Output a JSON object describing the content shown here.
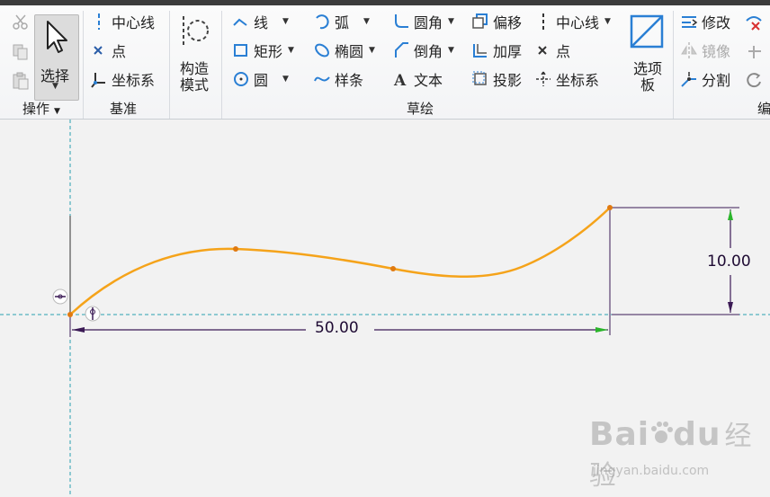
{
  "colors": {
    "accent": "#2a7fd4",
    "curve": "#f5a31a",
    "dimension": "#3b1a55",
    "axis": "#2aa0b0",
    "arrow_green": "#2bb52b"
  },
  "ops": {
    "select_label": "选择",
    "group_label": "操作"
  },
  "datum": {
    "items": [
      "中心线",
      "点",
      "坐标系"
    ],
    "group_label": "基准"
  },
  "construct": {
    "label_line1": "构造",
    "label_line2": "模式"
  },
  "sketch": {
    "col1": [
      "线",
      "矩形",
      "圆"
    ],
    "col2": [
      "弧",
      "椭圆",
      "样条"
    ],
    "col3": [
      "圆角",
      "倒角",
      "文本"
    ],
    "col4": [
      "偏移",
      "加厚",
      "投影"
    ],
    "col5": [
      "中心线",
      "点",
      "坐标系"
    ],
    "group_label": "草绘"
  },
  "palette": {
    "label_line1": "选项",
    "label_line2": "板"
  },
  "edit": {
    "items": [
      "修改",
      "镜像",
      "分割"
    ],
    "group_label": "编"
  },
  "dimensions": {
    "horizontal": "50.00",
    "vertical": "10.00"
  },
  "watermark": {
    "brand": "Bai",
    "brand2": "du",
    "cn": "经验",
    "url": "jingyan.baidu.com"
  }
}
